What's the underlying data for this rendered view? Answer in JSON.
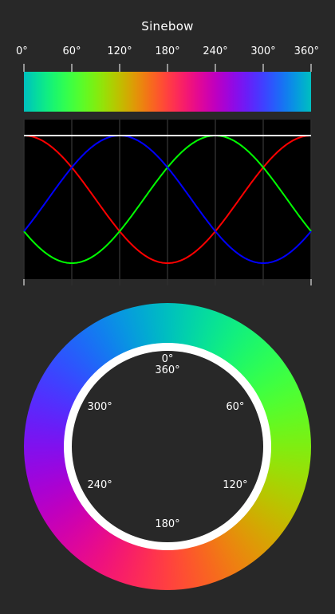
{
  "title": "Sinebow",
  "axis": {
    "degrees": [
      0,
      60,
      120,
      180,
      240,
      300,
      360
    ],
    "labels": [
      "0°",
      "60°",
      "120°",
      "180°",
      "240°",
      "300°",
      "360°"
    ]
  },
  "wheel": {
    "labels": [
      {
        "angle": 0,
        "line1": "0°",
        "line2": "360°"
      },
      {
        "angle": 60,
        "line1": "60°"
      },
      {
        "angle": 120,
        "line1": "120°"
      },
      {
        "angle": 180,
        "line1": "180°"
      },
      {
        "angle": 240,
        "line1": "240°"
      },
      {
        "angle": 300,
        "line1": "300°"
      }
    ]
  },
  "chart_data": {
    "type": "line",
    "x_range": [
      0,
      360
    ],
    "y_range": [
      0,
      1
    ],
    "grid": true,
    "series": [
      {
        "color": "#ff0000",
        "phase": 0
      },
      {
        "color": "#00ff00",
        "phase": 240
      },
      {
        "color": "#0000ff",
        "phase": 120
      },
      {
        "color": "#ffffff",
        "constant": 1
      }
    ]
  }
}
